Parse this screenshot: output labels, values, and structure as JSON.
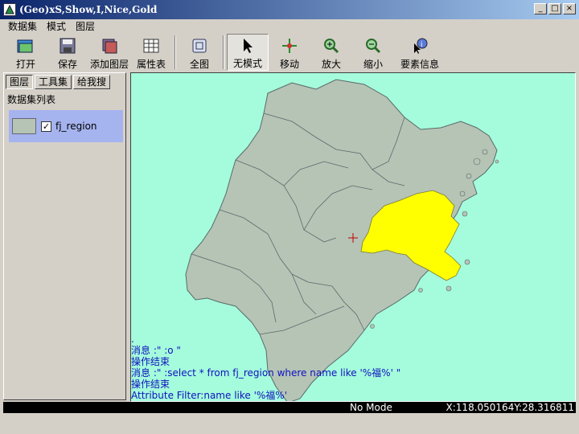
{
  "window": {
    "title": "(Geo)xS,Show,I,Nice,Gold",
    "buttons": {
      "minimize": "_",
      "maximize": "□",
      "close": "×"
    }
  },
  "menubar": {
    "items": [
      "数据集",
      "模式",
      "图层"
    ]
  },
  "toolbar": {
    "open": "打开",
    "save": "保存",
    "add_layer": "添加图层",
    "attribute_table": "属性表",
    "full_extent": "全图",
    "no_mode": "无模式",
    "pan": "移动",
    "zoom_in": "放大",
    "zoom_out": "缩小",
    "feature_info": "要素信息"
  },
  "panel": {
    "tabs": [
      "图层",
      "工具集",
      "给我搜"
    ],
    "active_tab": "图层",
    "list_title": "数据集列表",
    "layers": [
      {
        "name": "fj_region",
        "checked": true,
        "fill_color": "#b5c4b5"
      }
    ]
  },
  "map": {
    "background_color": "#a4fcdc",
    "region_color": "#b5c4b5",
    "highlight_color": "#ffff00",
    "log": [
      ".",
      "消息 :\" :o \"",
      "操作结束",
      "消息 :\" :select * from fj_region where name like '%福%' \"",
      "操作结束",
      "Attribute Filter:name like '%福%'"
    ]
  },
  "status": {
    "mode": "No Mode",
    "coords": "X:118.050164Y:28.316811"
  }
}
